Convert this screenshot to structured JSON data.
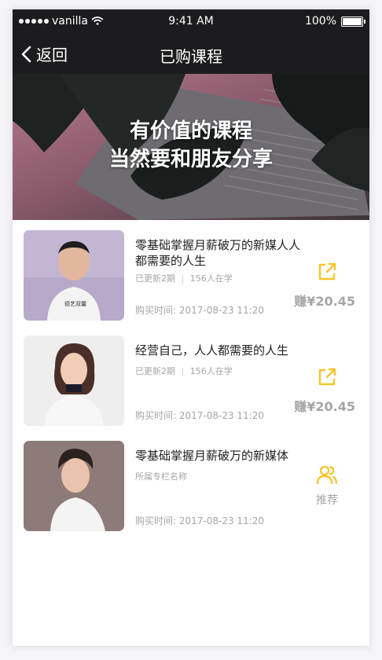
{
  "status_bar": {
    "carrier": "vanilla",
    "time": "9:41 AM",
    "battery": "100%"
  },
  "nav": {
    "back_label": "返回",
    "title": "已购课程"
  },
  "banner": {
    "line1": "有价值的课程",
    "line2": "当然要和朋友分享"
  },
  "courses": [
    {
      "title": "零基础掌握月薪破万的新媒人人都需要的人生",
      "meta_updates": "已更新2期",
      "meta_learners": "156人在学",
      "purchase_time": "购买时间: 2017-08-23 11:20",
      "action_icon": "share-icon",
      "action_label": "赚¥20.45"
    },
    {
      "title": "经营自己，人人都需要的人生",
      "meta_updates": "已更新2期",
      "meta_learners": "156人在学",
      "purchase_time": "购买时间: 2017-08-23 11:20",
      "action_icon": "share-icon",
      "action_label": "赚¥20.45"
    },
    {
      "title": "零基础掌握月薪破万的新媒体",
      "meta_updates": "所属专栏名称",
      "purchase_time": "购买时间: 2017-08-23 11:20",
      "action_icon": "users-icon",
      "action_label": "推荐"
    }
  ],
  "colors": {
    "accent": "#f6c42a",
    "dark": "#1c1c1e",
    "muted": "#a5a5a5"
  }
}
